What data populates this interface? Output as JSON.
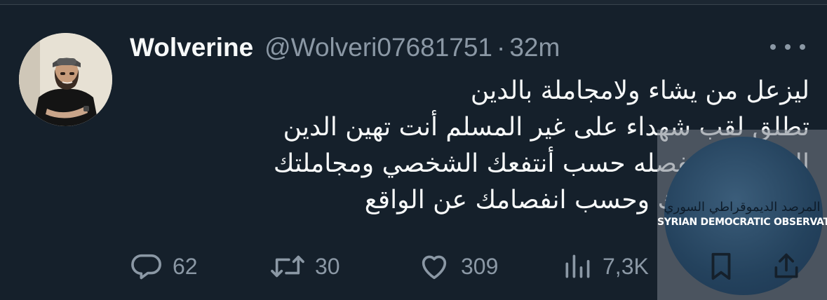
{
  "tweet": {
    "author": {
      "display_name": "Wolverine",
      "handle": "@Wolveri07681751"
    },
    "separator": "·",
    "time": "32m",
    "text_lines": [
      "ليزعل من يشاء ولامجاملة بالدين",
      "تطلق لقب شهداء على غير المسلم أنت تهين الدين",
      "الاسلامي وتفصله حسب أنتفعك الشخصي ومجاملتك",
      "وحسب أهوائك وحسب انفصامك عن الواقع"
    ],
    "actions": {
      "replies": "62",
      "retweets": "30",
      "likes": "309",
      "views": "7,3K"
    }
  },
  "icons": {
    "reply": "reply-bubble-icon",
    "retweet": "retweet-arrows-icon",
    "like": "heart-icon",
    "views": "bar-chart-icon",
    "bookmark": "bookmark-icon",
    "share": "share-upload-icon",
    "more": "more-dots-icon"
  },
  "watermark": {
    "arabic": "المرصد الديموقراطي السوري",
    "english": "SYRIAN DEMOCRATIC OBSERVATORY"
  },
  "colors": {
    "background": "#15202b",
    "text": "#f7f9f9",
    "secondary": "#8b98a5"
  }
}
